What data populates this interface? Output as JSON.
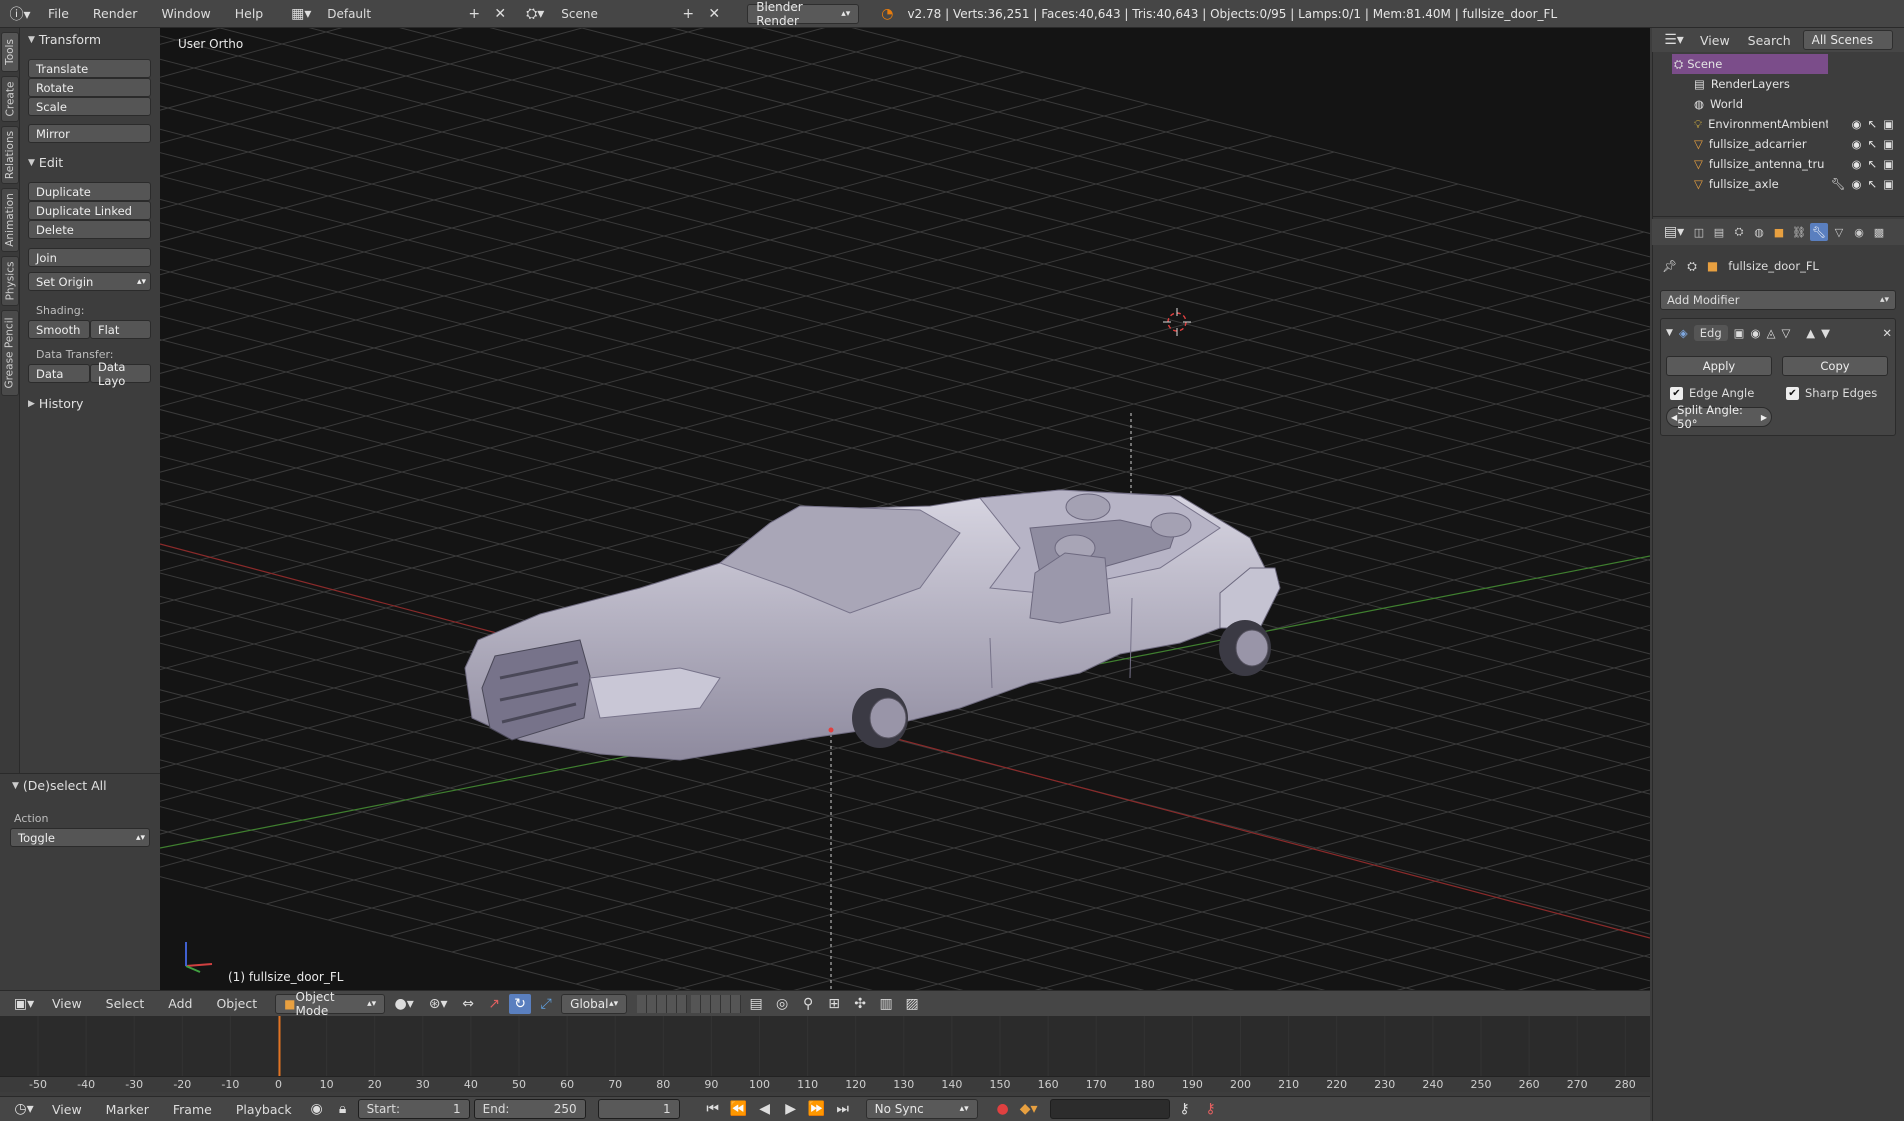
{
  "topbar": {
    "menus": [
      "File",
      "Render",
      "Window",
      "Help"
    ],
    "layout": "Default",
    "scene": "Scene",
    "engine": "Blender Render",
    "stats": "v2.78 | Verts:36,251 | Faces:40,643 | Tris:40,643 | Objects:0/95 | Lamps:0/1 | Mem:81.40M | fullsize_door_FL"
  },
  "tabs": [
    "Tools",
    "Create",
    "Relations",
    "Animation",
    "Physics",
    "Grease Pencil"
  ],
  "toolshelf": {
    "transform_title": "Transform",
    "translate": "Translate",
    "rotate": "Rotate",
    "scale": "Scale",
    "mirror": "Mirror",
    "edit_title": "Edit",
    "duplicate": "Duplicate",
    "duplicate_linked": "Duplicate Linked",
    "delete": "Delete",
    "join": "Join",
    "set_origin": "Set Origin",
    "shading_label": "Shading:",
    "smooth": "Smooth",
    "flat": "Flat",
    "data_transfer_label": "Data Transfer:",
    "data": "Data",
    "data_layout": "Data Layo",
    "history_title": "History"
  },
  "operator": {
    "title": "(De)select All",
    "action_label": "Action",
    "action_value": "Toggle"
  },
  "viewport": {
    "view_label": "User Ortho",
    "object_label": "(1) fullsize_door_FL"
  },
  "vpheader": {
    "menus": [
      "View",
      "Select",
      "Add",
      "Object"
    ],
    "mode": "Object Mode",
    "orientation": "Global"
  },
  "timeline": {
    "ticks": [
      "-50",
      "-40",
      "-30",
      "-20",
      "-10",
      "0",
      "10",
      "20",
      "30",
      "40",
      "50",
      "60",
      "70",
      "80",
      "90",
      "100",
      "110",
      "120",
      "130",
      "140",
      "150",
      "160",
      "170",
      "180",
      "190",
      "200",
      "210",
      "220",
      "230",
      "240",
      "250",
      "260",
      "270",
      "280"
    ],
    "current_frame_marker": 0,
    "menus": [
      "View",
      "Marker",
      "Frame",
      "Playback"
    ],
    "start_label": "Start:",
    "start_value": "1",
    "end_label": "End:",
    "end_value": "250",
    "frame_value": "1",
    "sync": "No Sync"
  },
  "outliner": {
    "view": "View",
    "search": "Search",
    "filter": "All Scenes",
    "items": [
      {
        "label": "Scene",
        "icon": "scene-icon"
      },
      {
        "label": "RenderLayers",
        "icon": "renderlayers-icon"
      },
      {
        "label": "World",
        "icon": "world-icon"
      },
      {
        "label": "EnvironmentAmbientLi",
        "icon": "lamp-icon"
      },
      {
        "label": "fullsize_adcarrier",
        "icon": "mesh-icon"
      },
      {
        "label": "fullsize_antenna_trunk",
        "icon": "mesh-icon"
      },
      {
        "label": "fullsize_axle",
        "icon": "mesh-icon"
      }
    ]
  },
  "properties": {
    "object_name": "fullsize_door_FL",
    "add_modifier": "Add Modifier",
    "modifier_name": "Edg",
    "apply": "Apply",
    "copy": "Copy",
    "edge_angle": "Edge Angle",
    "sharp_edges": "Sharp Edges",
    "split_angle": "Split Angle: 50°"
  },
  "colors": {
    "viewport_bg": "#141414",
    "grid": "#3a3a3a",
    "x_axis": "#8a2a2a",
    "y_axis": "#3f7f2f",
    "selected_blue": "#5a7fbf",
    "frame_marker": "#e27322",
    "car_body": "#b9b6c8"
  }
}
